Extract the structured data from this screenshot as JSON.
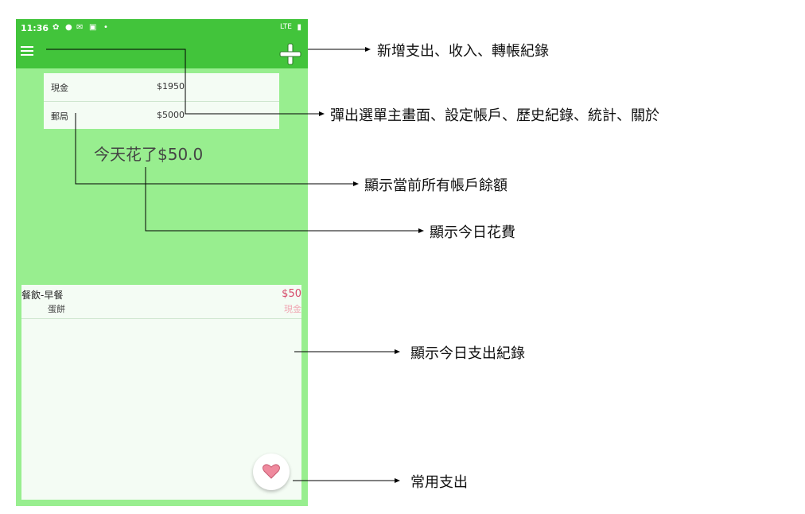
{
  "status_bar": {
    "time": "11:36",
    "network": "LTE"
  },
  "accounts": [
    {
      "name": "現金",
      "balance": "$1950"
    },
    {
      "name": "郵局",
      "balance": "$5000"
    }
  ],
  "today_spent": "今天花了$50.0",
  "records": [
    {
      "category": "餐飲-早餐",
      "note": "蛋餅",
      "amount": "$50",
      "account": "現金"
    }
  ],
  "annotations": {
    "add": "新增支出、收入、轉帳紀錄",
    "menu": "彈出選單主畫面、設定帳戶、歷史紀錄、統計、關於",
    "balances": "顯示當前所有帳戶餘額",
    "today_cost": "顯示今日花費",
    "today_records": "顯示今日支出紀錄",
    "favorites": "常用支出"
  },
  "colors": {
    "toolbar": "#42c43b",
    "background": "#98ee8f",
    "amount": "#d64a6a",
    "heart": "#ef8a9e"
  }
}
